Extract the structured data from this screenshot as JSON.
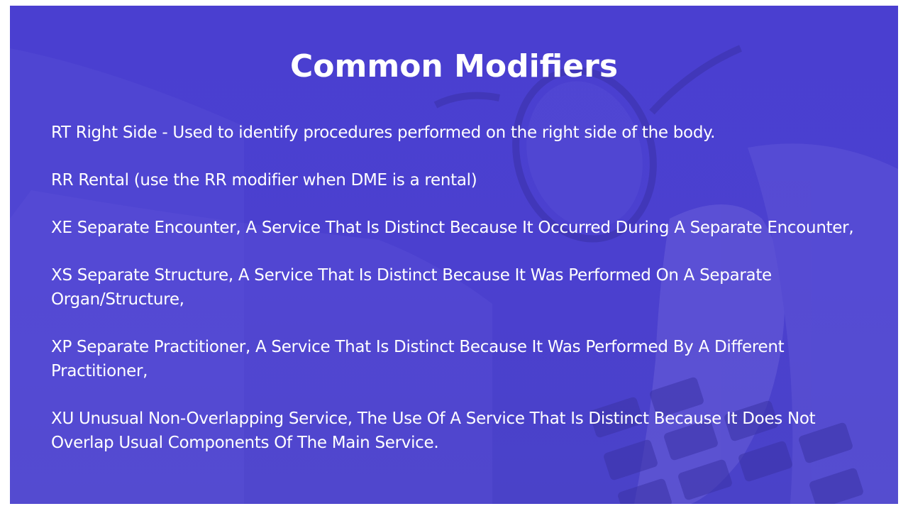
{
  "slide": {
    "title": "Common Modifiers",
    "items": [
      "RT Right Side - Used to identify procedures performed on the right side of the body.",
      "RR Rental (use the RR modifier when DME is a rental)",
      "XE Separate Encounter, A Service That Is Distinct Because It Occurred During A Separate Encounter,",
      "XS Separate Structure, A Service That Is Distinct Because It Was Performed On A Separate Organ/Structure,",
      "XP Separate Practitioner, A Service That Is Distinct Because It Was Performed By A Different Practitioner,",
      "XU Unusual Non-Overlapping Service, The Use Of A Service That Is Distinct Because It Does Not Overlap Usual Components Of The Main Service."
    ]
  },
  "colors": {
    "background": "#4a3fd0",
    "text": "#ffffff"
  }
}
